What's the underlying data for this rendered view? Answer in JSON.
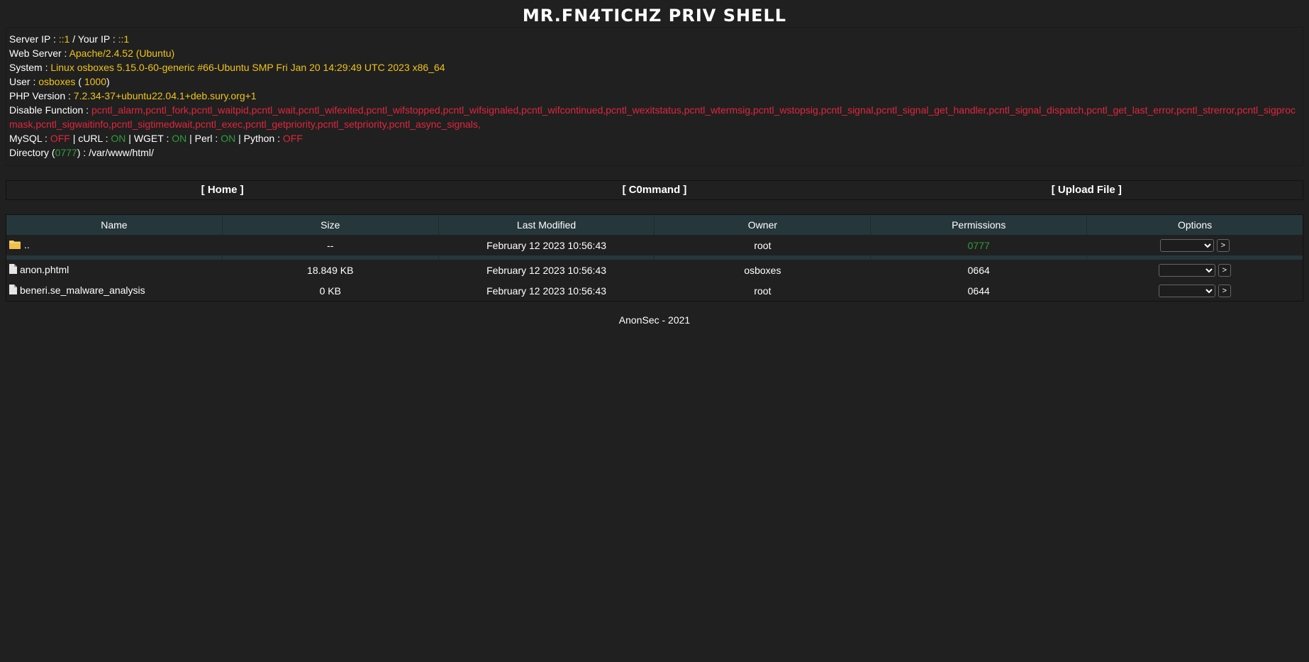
{
  "title": "MR.FN4TICHZ PRIV SHELL",
  "info": {
    "server_ip_label": "Server IP : ",
    "server_ip": "::1",
    "your_ip_sep": " / Your IP : ",
    "your_ip": "::1",
    "web_server_label": "Web Server : ",
    "web_server": "Apache/2.4.52 (Ubuntu)",
    "system_label": "System : ",
    "system": "Linux osboxes 5.15.0-60-generic #66-Ubuntu SMP Fri Jan 20 14:29:49 UTC 2023 x86_64",
    "user_label": "User : ",
    "user": "osboxes",
    "user_id_open": " ( ",
    "user_id": "1000",
    "user_id_close": ")",
    "php_label": "PHP Version : ",
    "php": "7.2.34-37+ubuntu22.04.1+deb.sury.org+1",
    "disable_label": "Disable Function : ",
    "disable": "pcntl_alarm,pcntl_fork,pcntl_waitpid,pcntl_wait,pcntl_wifexited,pcntl_wifstopped,pcntl_wifsignaled,pcntl_wifcontinued,pcntl_wexitstatus,pcntl_wtermsig,pcntl_wstopsig,pcntl_signal,pcntl_signal_get_handler,pcntl_signal_dispatch,pcntl_get_last_error,pcntl_strerror,pcntl_sigprocmask,pcntl_sigwaitinfo,pcntl_sigtimedwait,pcntl_exec,pcntl_getpriority,pcntl_setpriority,pcntl_async_signals,",
    "mysql_label": "MySQL : ",
    "mysql": "OFF",
    "curl_label": " | cURL : ",
    "curl": "ON",
    "wget_label": " | WGET : ",
    "wget": "ON",
    "perl_label": " | Perl : ",
    "perl": "ON",
    "python_label": " | Python : ",
    "python": "OFF",
    "dir_label": "Directory (",
    "dir_perm": "0777",
    "dir_sep": ") : ",
    "dir_path": "/var/www/html/"
  },
  "nav": {
    "home": "[ Home ]",
    "command": "[ C0mmand ]",
    "upload": "[ Upload File ]"
  },
  "table": {
    "headers": [
      "Name",
      "Size",
      "Last Modified",
      "Owner",
      "Permissions",
      "Options"
    ],
    "parent": {
      "name": "..",
      "size": "--",
      "modified": "February 12 2023 10:56:43",
      "owner": "root",
      "perms": "0777"
    },
    "rows": [
      {
        "name": "anon.phtml",
        "size": "18.849 KB",
        "modified": "February 12 2023 10:56:43",
        "owner": "osboxes",
        "perms": "0664"
      },
      {
        "name": "beneri.se_malware_analysis",
        "size": "0 KB",
        "modified": "February 12 2023 10:56:43",
        "owner": "root",
        "perms": "0644"
      }
    ],
    "go_label": ">"
  },
  "footer": "AnonSec - 2021",
  "colors": {
    "background": "#202020",
    "header_row": "#26373b",
    "yellow": "#f0c419",
    "red": "#e0263c",
    "green": "#2e9e3a"
  }
}
